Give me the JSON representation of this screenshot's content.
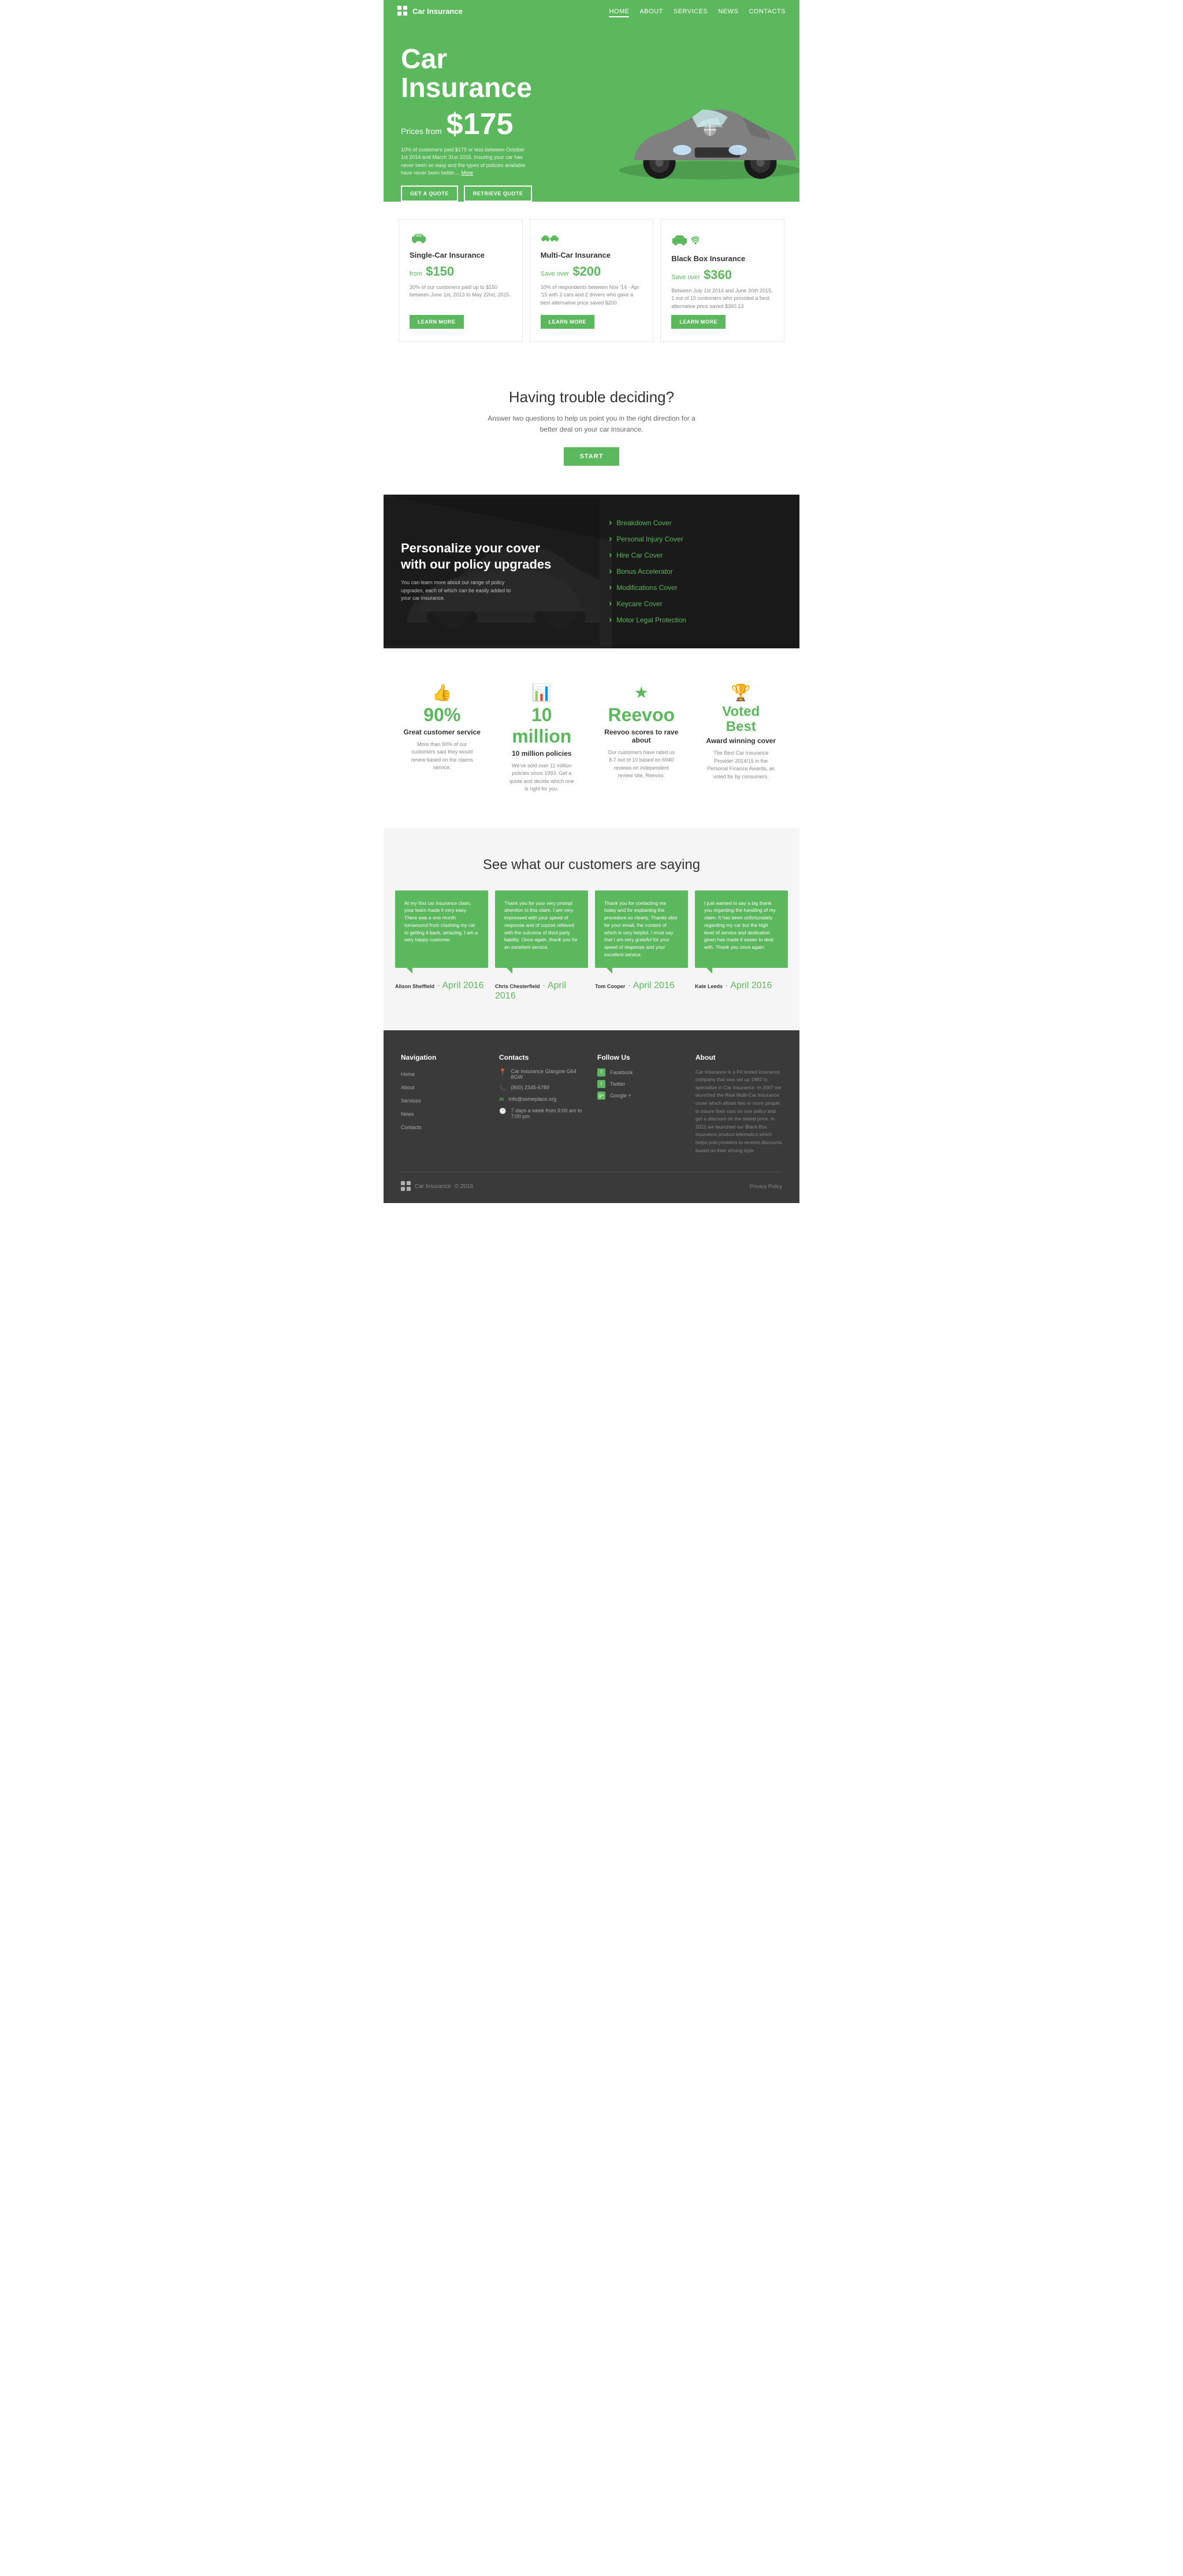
{
  "nav": {
    "logo": "Car Insurance",
    "links": [
      {
        "label": "HOME",
        "active": true
      },
      {
        "label": "ABOUT",
        "active": false
      },
      {
        "label": "SERVICES",
        "active": false
      },
      {
        "label": "NEWS",
        "active": false
      },
      {
        "label": "CONTACTS",
        "active": false
      }
    ]
  },
  "hero": {
    "title": "Car\nInsurance",
    "price_label": "Prices from",
    "price": "$175",
    "description": "10% of customers paid $175 or less between October 1st 2014 and March 31st 2015. Insuring your car has never been so easy and the types of policies available have never been better....",
    "more_link": "More",
    "btn_quote": "GET A QUOTE",
    "btn_retrieve": "RETRIEVE QUOTE"
  },
  "insurance_cards": [
    {
      "title": "Single-Car Insurance",
      "price_label": "from",
      "price": "$150",
      "description": "30% of our customers paid up to $150 between June 1st, 2013 to May 22nd, 2015.",
      "btn": "LEARN MORE",
      "icon_type": "single"
    },
    {
      "title": "Multi-Car Insurance",
      "price_label": "Save over",
      "price": "$200",
      "description": "10% of respondents between Nov '14 - Apr '15 with 2 cars and 2 drivers who gave a best alternative price saved $200",
      "btn": "LEARN MORE",
      "icon_type": "multi"
    },
    {
      "title": "Black Box Insurance",
      "price_label": "Save over",
      "price": "$360",
      "description": "Between July 1st 2014 and June 30th 2015, 1 out of 10 customers who provided a best alternative price saved $360.13",
      "btn": "LEARN MORE",
      "icon_type": "blackbox"
    }
  ],
  "trouble": {
    "title": "Having trouble deciding?",
    "description": "Answer two questions to help us point you in the right direction for a better deal on your car insurance.",
    "btn": "START"
  },
  "policy": {
    "title": "Personalize your cover\nwith our policy upgrades",
    "description": "You can learn more about our range of policy upgrades, each of which can be easily added to your car insurance.",
    "upgrades": [
      "Breakdown Cover",
      "Personal Injury Cover",
      "Hire Car Cover",
      "Bonus Accelerator",
      "Modifications Cover",
      "Keycare Cover",
      "Motor Legal Protection"
    ]
  },
  "stats": [
    {
      "number": "90%",
      "label": "Great customer service",
      "desc": "More than 90% of our customers said they would renew based on the claims service.",
      "icon": "thumbs-up"
    },
    {
      "number": "10 million",
      "label": "10 million policies",
      "desc": "We've sold over 11 million policies since 1993. Get a quote and decide which one is right for you.",
      "icon": "chart"
    },
    {
      "number": "Reevoo",
      "label": "Reevoo scores to rave about",
      "desc": "Our customers have rated us 8.7 out of 10 based on 6940 reviews on independent review site, Reevoo.",
      "icon": "star"
    },
    {
      "number": "Voted\nBest",
      "label": "Award winning cover",
      "desc": "The Best Car Insurance Provider 2014/15 in the Personal Finance Awards, as voted for by consumers.",
      "icon": "trophy"
    }
  ],
  "testimonials": {
    "title": "See what our customers are saying",
    "items": [
      {
        "text": "At my first car insurance claim, your team made it very easy. There was a one month turnaround from crashing my car to getting it back, amazing. I am a very happy customer.",
        "author": "Alison Sheffield",
        "date": "April 2016"
      },
      {
        "text": "Thank you for your very prompt attention to this claim. I am very impressed with your speed of response and of course relieved with the outcome of third party liability. Once again, thank you for an excellent service.",
        "author": "Chris Chesterfield",
        "date": "April 2016"
      },
      {
        "text": "Thank you for contacting me today and for explaining the procedure so clearly. Thanks also for your email, the content of which is very helpful. I must say that I am very grateful for your speed of response and your excellent service.",
        "author": "Tom Cooper",
        "date": "April 2016"
      },
      {
        "text": "I just wanted to say a big thank you regarding the handling of my claim. It has been unfortunately regarding my car but the high level of service and dedication given has made it easier to deal with. Thank you once again.",
        "author": "Kate Leeds",
        "date": "April 2016"
      }
    ]
  },
  "footer": {
    "navigation": {
      "title": "Navigation",
      "links": [
        "Home",
        "About",
        "Services",
        "News",
        "Contacts"
      ]
    },
    "contacts": {
      "title": "Contacts",
      "address": "Car Insurance Glasgow G64 8GW",
      "phone": "(800) 2345-6789",
      "email": "info@someplace.org",
      "hours": "7 days a week from 9:00 am to 7:00 pm"
    },
    "social": {
      "title": "Follow Us",
      "links": [
        "Facebook",
        "Twitter",
        "Google +"
      ]
    },
    "about": {
      "title": "About",
      "text": "Car Insurance is a FII tested insurance company that was set up 1992 to specialize in Car Insurance. In 2007 we launched the Real Multi-Car Insurance cover which allows two or more people to insure their cars on one policy and get a discount on the stated price. In 2012 we launched our Black Box insurance product telematics which helps policyholders to receive discounts based on their driving style."
    },
    "bottom": {
      "logo": "Car Insurance",
      "copyright": "© 2016",
      "privacy": "Privacy Policy"
    }
  }
}
